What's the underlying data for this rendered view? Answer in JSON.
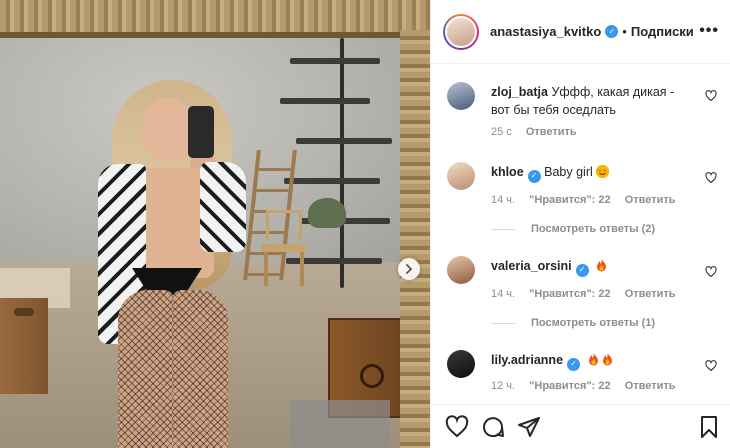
{
  "header": {
    "username": "anastasiya_kvitko",
    "verified_icon": "verified-badge-icon",
    "separator": "•",
    "follow_label": "Подписки",
    "more_icon": "ellipsis-icon"
  },
  "comments": [
    {
      "username": "zloj_batja",
      "verified": false,
      "text": "Уффф, какая дикая - вот бы тебя оседлать",
      "time": "25 с",
      "likes_label": "",
      "reply_label": "Ответить",
      "replies_label": ""
    },
    {
      "username": "khloe",
      "verified": true,
      "text": "Baby girl",
      "emoji": "heart-eyes-emoji",
      "time": "14 ч.",
      "likes_label": "\"Нравится\": 22",
      "reply_label": "Ответить",
      "replies_label": "Посмотреть ответы (2)"
    },
    {
      "username": "valeria_orsini",
      "verified": true,
      "text": "",
      "emoji": "fire-emoji",
      "time": "14 ч.",
      "likes_label": "\"Нравится\": 22",
      "reply_label": "Ответить",
      "replies_label": "Посмотреть ответы (1)"
    },
    {
      "username": "lily.adrianne",
      "verified": true,
      "text": "",
      "emoji": "fire-emoji fire-emoji",
      "time": "12 ч.",
      "likes_label": "\"Нравится\": 22",
      "reply_label": "Ответить",
      "replies_label": ""
    }
  ],
  "actions": {
    "like_icon": "heart-icon",
    "comment_icon": "comment-icon",
    "share_icon": "send-icon",
    "save_icon": "bookmark-icon"
  },
  "colors": {
    "verified": "#3897f0",
    "muted": "#8e8e8e",
    "text": "#262626",
    "border": "#efefef"
  }
}
